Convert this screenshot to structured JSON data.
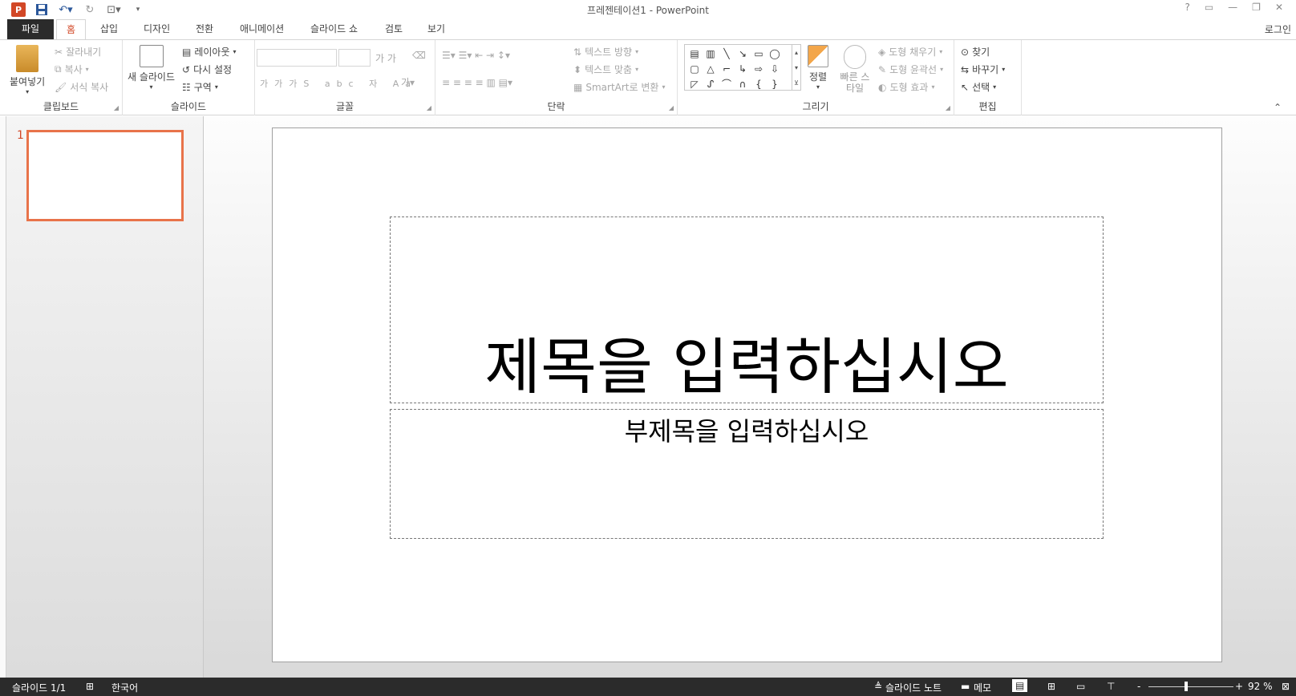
{
  "window": {
    "title": "프레젠테이션1 - PowerPoint"
  },
  "qat": {
    "app_icon": "P",
    "save_icon": "save-icon",
    "undo_icon": "undo-icon",
    "redo_icon": "redo-icon",
    "start_icon": "present-icon"
  },
  "window_buttons": [
    "?",
    "▭",
    "—",
    "❐",
    "✕"
  ],
  "tabs": [
    {
      "label": "파일"
    },
    {
      "label": "홈"
    },
    {
      "label": "삽입"
    },
    {
      "label": "디자인"
    },
    {
      "label": "전환"
    },
    {
      "label": "애니메이션"
    },
    {
      "label": "슬라이드 쇼"
    },
    {
      "label": "검토"
    },
    {
      "label": "보기"
    }
  ],
  "account": {
    "login": "로그인"
  },
  "ribbon": {
    "clipboard": {
      "label": "클립보드",
      "paste": "붙여넣기",
      "cut": "잘라내기",
      "copy": "복사",
      "format_painter": "서식 복사"
    },
    "slides": {
      "label": "슬라이드",
      "new_slide": "새 슬라이드",
      "layout": "레이아웃",
      "reset": "다시 설정",
      "section": "구역"
    },
    "font": {
      "label": "글꼴"
    },
    "paragraph": {
      "label": "단락",
      "text_direction": "텍스트 방향",
      "align_text": "텍스트 맞춤",
      "smartart": "SmartArt로 변환"
    },
    "drawing": {
      "label": "그리기",
      "arrange": "정렬",
      "quick_styles": "빠른 스타일",
      "fill": "도형 채우기",
      "outline": "도형 윤곽선",
      "effects": "도형 효과"
    },
    "editing": {
      "label": "편집",
      "find": "찾기",
      "replace": "바꾸기",
      "select": "선택"
    }
  },
  "thumbnails": [
    {
      "number": "1"
    }
  ],
  "slide": {
    "title_placeholder": "제목을 입력하십시오",
    "subtitle_placeholder": "부제목을 입력하십시오"
  },
  "status": {
    "slide_count": "슬라이드 1/1",
    "language": "한국어",
    "notes": "슬라이드 노트",
    "comments": "메모",
    "zoom_minus": "-",
    "zoom_plus": "+",
    "zoom": "92 %"
  },
  "colors": {
    "accent": "#d24726",
    "thumb_border": "#e8734a",
    "statusbar": "#2b2b2b"
  }
}
